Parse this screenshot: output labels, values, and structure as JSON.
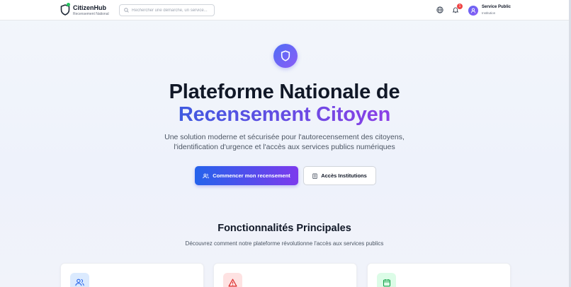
{
  "header": {
    "brand_title": "CitizenHub",
    "brand_subtitle": "Recensement National",
    "search_placeholder": "Rechercher une démarche, un service...",
    "notification_count": "1",
    "user_name": "Service Public",
    "user_role": "Institution"
  },
  "hero": {
    "icon": "shield-icon",
    "title_line1": "Plateforme Nationale de",
    "title_line2": "Recensement Citoyen",
    "description_line1": "Une solution moderne et sécurisée pour l'autorecensement des citoyens,",
    "description_line2": "l'identification d'urgence et l'accès aux services publics numériques",
    "primary_button": "Commencer mon recensement",
    "secondary_button": "Accès Institutions"
  },
  "features": {
    "title": "Fonctionnalités Principales",
    "subtitle": "Découvrez comment notre plateforme révolutionne l'accès aux services publics",
    "cards": [
      {
        "icon": "users-icon",
        "color": "#dbeafe"
      },
      {
        "icon": "alert-triangle-icon",
        "color": "#fee2e2"
      },
      {
        "icon": "calendar-icon",
        "color": "#dcfce7"
      }
    ]
  },
  "colors": {
    "accent_start": "#2563eb",
    "accent_end": "#7c3aed",
    "badge": "#ef4444",
    "logo_dot": "#22c55e"
  }
}
